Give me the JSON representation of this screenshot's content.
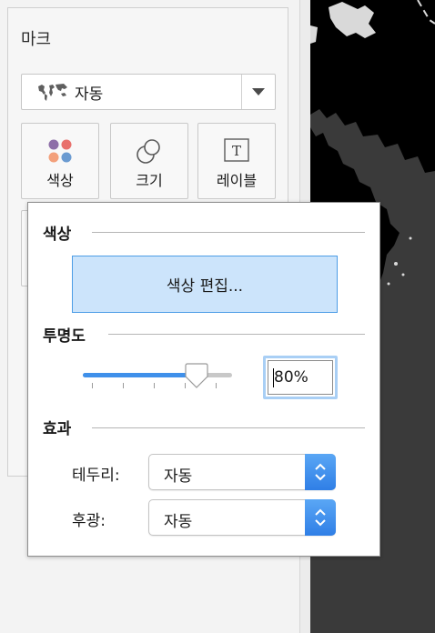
{
  "marks": {
    "title": "마크",
    "mark_type": {
      "label": "자동",
      "icon": "map-icon"
    },
    "buttons": [
      {
        "label": "색상",
        "icon": "color-dots-icon"
      },
      {
        "label": "크기",
        "icon": "size-circles-icon"
      },
      {
        "label": "레이블",
        "icon": "text-label-icon"
      }
    ]
  },
  "popover": {
    "color_section": {
      "heading": "색상",
      "edit_button": "색상 편집..."
    },
    "opacity_section": {
      "heading": "투명도",
      "value": "80%",
      "level_fraction": 0.8
    },
    "effects_section": {
      "heading": "효과",
      "border": {
        "label": "테두리:",
        "value": "자동"
      },
      "halo": {
        "label": "후광:",
        "value": "자동"
      }
    }
  },
  "colors": {
    "accent": "#3f90ea",
    "selection_fill": "#cce4fb",
    "dot_purple": "#8e6fa8",
    "dot_red": "#e8706c",
    "dot_orange": "#f3a07b",
    "dot_blue": "#6b9bd1",
    "map_background": "#000000",
    "map_land": "#d9d9d9"
  }
}
